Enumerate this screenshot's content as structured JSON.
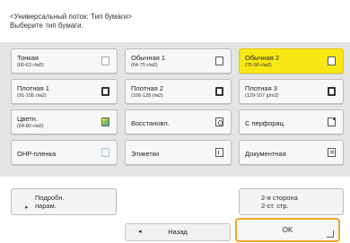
{
  "header": {
    "title": "<Универсальный поток: Тип бумаги>",
    "instruction": "Выберите тип бумаги."
  },
  "paper_types": [
    {
      "label": "Тонкая",
      "sub": "(60-63 г/м2)",
      "icon": "paper-thin-icon",
      "selected": false
    },
    {
      "label": "Обычная 1",
      "sub": "(64-75 г/м2)",
      "icon": "paper-plain-icon",
      "selected": false
    },
    {
      "label": "Обычная 2",
      "sub": "(76-90 г/м2)",
      "icon": "paper-plain-icon",
      "selected": true
    },
    {
      "label": "Плотная 1",
      "sub": "(91-105 г/м2)",
      "icon": "paper-heavy-icon",
      "selected": false
    },
    {
      "label": "Плотная 2",
      "sub": "(106-128 г/м2)",
      "icon": "paper-heavy-icon",
      "selected": false
    },
    {
      "label": "Плотная 3",
      "sub": "(129-157 g/m2)",
      "icon": "paper-heavy-icon",
      "selected": false
    },
    {
      "label": "Цветн.",
      "sub": "(64-80 г/м2)",
      "icon": "paper-color-icon",
      "selected": false
    },
    {
      "label": "Восстановл.",
      "sub": "",
      "icon": "recycled-icon",
      "selected": false
    },
    {
      "label": "С перфорац.",
      "sub": "",
      "icon": "prepunched-icon",
      "selected": false
    },
    {
      "label": "OHP-пленка",
      "sub": "",
      "icon": "transparency-icon",
      "selected": false
    },
    {
      "label": "Этикетки",
      "sub": "",
      "icon": "labels-icon",
      "selected": false
    },
    {
      "label": "Документная",
      "sub": "",
      "icon": "bond-paper-icon",
      "selected": false
    }
  ],
  "details_button": {
    "line1": "Подробн.",
    "line2": "парам.",
    "arrow": "▸"
  },
  "side2_button": {
    "line1": "2-я сторона",
    "line2": "2-ст. стр."
  },
  "back_button": {
    "label": "Назад",
    "arrow": "◂"
  },
  "ok_button": {
    "label": "OK"
  },
  "colors": {
    "selected": "#f8e716",
    "ok_border": "#f3a629",
    "panel_bg": "#e4e4e4"
  }
}
